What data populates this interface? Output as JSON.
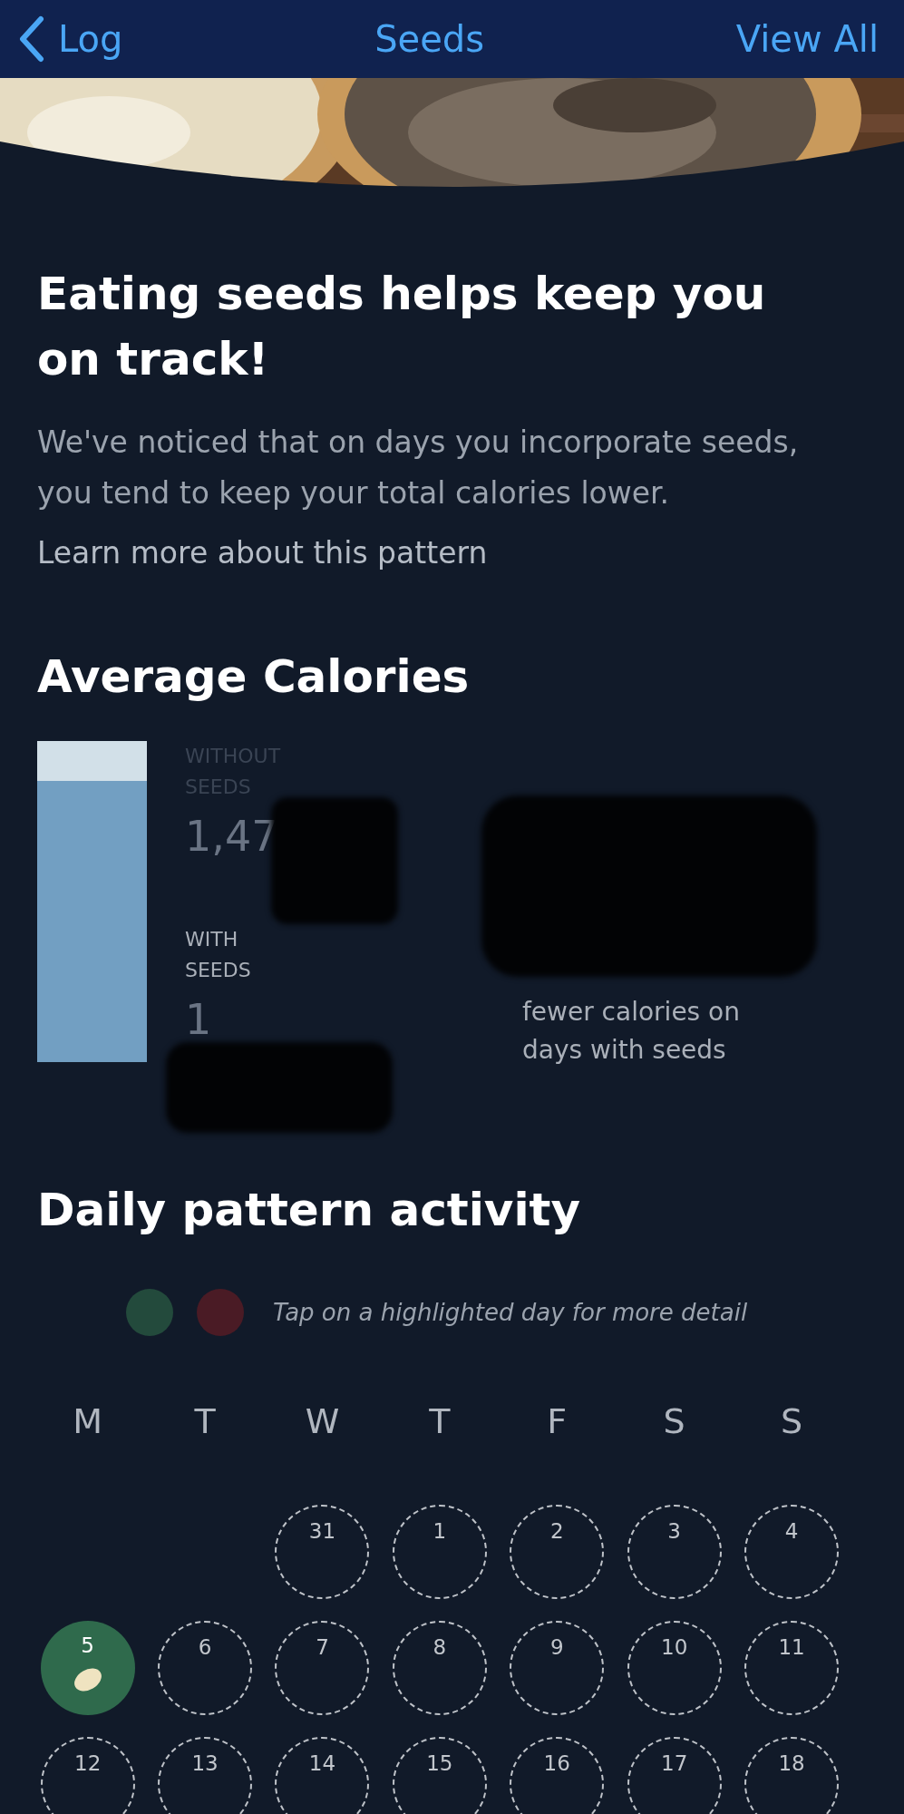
{
  "nav": {
    "back": "Log",
    "title": "Seeds",
    "action": "View All"
  },
  "insight": {
    "title": "Eating seeds helps keep you on track!",
    "body": "We've noticed that on days you incorporate seeds, you tend to keep your total calories lower.",
    "link": "Learn more about this pattern"
  },
  "average": {
    "title": "Average Calories",
    "without_label": "WITHOUT SEEDS",
    "without_value": "1,47",
    "with_label": "WITH SEEDS",
    "with_value": "1",
    "difference_caption": "fewer calories on days with seeds"
  },
  "activity": {
    "title": "Daily pattern activity",
    "legend": [
      {
        "color": "#234a3c"
      },
      {
        "color": "#4a1b25"
      }
    ],
    "hint": "Tap on a highlighted day for more detail",
    "weekdays": [
      "M",
      "T",
      "W",
      "T",
      "F",
      "S",
      "S"
    ],
    "weeks": [
      [
        {
          "kind": "blank"
        },
        {
          "kind": "blank"
        },
        {
          "kind": "open",
          "day": "31"
        },
        {
          "kind": "open",
          "day": "1"
        },
        {
          "kind": "open",
          "day": "2"
        },
        {
          "kind": "open",
          "day": "3"
        },
        {
          "kind": "open",
          "day": "4"
        }
      ],
      [
        {
          "kind": "logged",
          "day": "5",
          "color": "#2f6a4c"
        },
        {
          "kind": "open",
          "day": "6"
        },
        {
          "kind": "open",
          "day": "7"
        },
        {
          "kind": "open",
          "day": "8"
        },
        {
          "kind": "open",
          "day": "9"
        },
        {
          "kind": "open",
          "day": "10"
        },
        {
          "kind": "open",
          "day": "11"
        }
      ],
      [
        {
          "kind": "open",
          "day": "12"
        },
        {
          "kind": "open",
          "day": "13"
        },
        {
          "kind": "open",
          "day": "14"
        },
        {
          "kind": "open",
          "day": "15"
        },
        {
          "kind": "open",
          "day": "16"
        },
        {
          "kind": "open",
          "day": "17"
        },
        {
          "kind": "open",
          "day": "18"
        }
      ]
    ]
  }
}
